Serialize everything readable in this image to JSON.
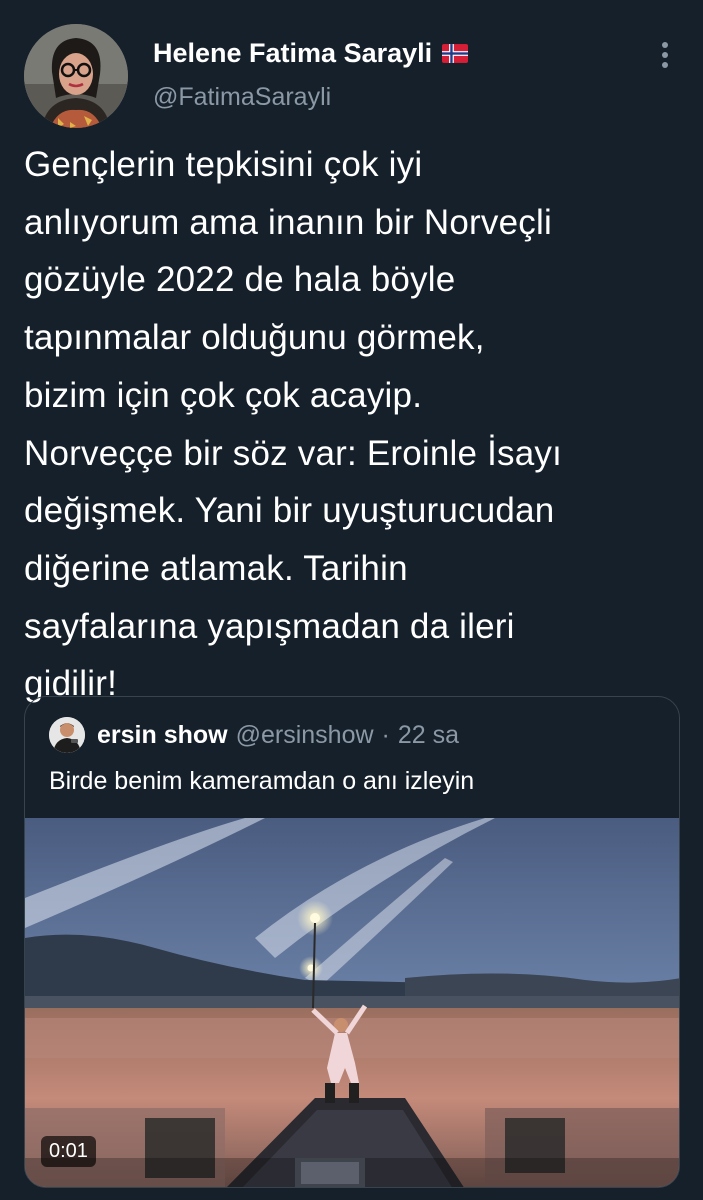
{
  "author": {
    "display_name": "Helene Fatima Sarayli",
    "handle": "@FatimaSarayli",
    "flag_icon": "norway-flag-icon"
  },
  "tweet": {
    "lines": [
      "Gençlerin tepkisini çok iyi",
      "anlıyorum ama inanın bir Norveçli",
      "gözüyle 2022 de hala böyle",
      "tapınmalar olduğunu görmek,",
      "bizim için çok çok acayip.",
      "Norveççe bir söz var: Eroinle İsayı",
      "değişmek. Yani bir uyuşturucudan",
      "diğerine atlamak. Tarihin",
      "sayfalarına yapışmadan da ileri",
      "gidilir!"
    ]
  },
  "quoted": {
    "display_name": "ersin show",
    "handle": "@ersinshow",
    "separator": "·",
    "time": "22 sa",
    "text": "Birde benim kameramdan o anı izleyin",
    "video_timestamp": "0:01"
  },
  "colors": {
    "background": "#15202b",
    "text_primary": "#ffffff",
    "text_secondary": "#8b98a5",
    "border": "#38444d"
  }
}
